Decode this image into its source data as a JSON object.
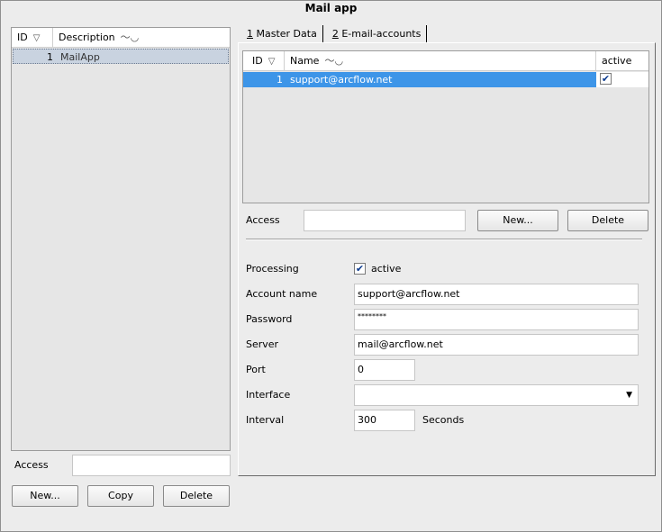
{
  "window": {
    "title": "Mail app"
  },
  "left": {
    "columns": [
      "ID",
      "Description"
    ],
    "rows": [
      {
        "id": "1",
        "description": "MailApp"
      }
    ],
    "access_label": "Access",
    "access_value": "",
    "buttons": {
      "new": "New...",
      "copy": "Copy",
      "delete": "Delete"
    }
  },
  "tabs": [
    {
      "num": "1",
      "label": " Master Data"
    },
    {
      "num": "2",
      "label": " E-mail-accounts"
    }
  ],
  "accounts": {
    "columns": [
      "ID",
      "Name",
      "active"
    ],
    "rows": [
      {
        "id": "1",
        "name": "support@arcflow.net",
        "active": true
      }
    ],
    "access_label": "Access",
    "access_value": "",
    "buttons": {
      "new": "New...",
      "delete": "Delete"
    }
  },
  "form": {
    "processing_label": "Processing",
    "processing_checkbox_label": "active",
    "processing_checked": true,
    "account_name_label": "Account name",
    "account_name_value": "support@arcflow.net",
    "password_label": "Password",
    "password_value": "********",
    "server_label": "Server",
    "server_value": "mail@arcflow.net",
    "port_label": "Port",
    "port_value": "0",
    "interface_label": "Interface",
    "interface_value": "",
    "interval_label": "Interval",
    "interval_value": "300",
    "interval_unit": "Seconds"
  },
  "colors": {
    "selection": "#3d95e8",
    "selection_left": "#c9d3e0"
  },
  "icons": [
    "sort-icon",
    "wave-icon",
    "checkbox-icon",
    "dropdown-arrow-icon"
  ]
}
